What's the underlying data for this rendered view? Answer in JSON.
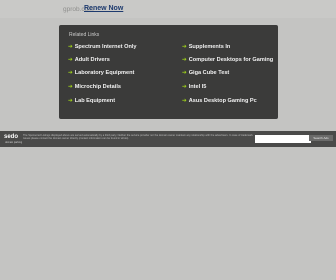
{
  "topbar": {
    "domain": "gprob.com",
    "renew_label": "Renew Now"
  },
  "related": {
    "title": "Related Links",
    "arrow": "➔",
    "left": [
      "Spectrum Internet Only",
      "Adult Drivers",
      "Laboratory Equipment",
      "Microchip Details",
      "Lab Equipment"
    ],
    "right": [
      "Supplements In",
      "Computer Desktops for Gaming",
      "Giga Cube Test",
      "Intel I5",
      "Asus Desktop Gaming Pc"
    ]
  },
  "footer": {
    "logo": "sedo",
    "logo_sub": "domain parking",
    "text": "The Sponsored Listings displayed above are served automatically by a third party. Neither the service provider nor the domain owner maintain any relationship with the advertisers. In case of trademark issues please contact the domain owner directly (contact information can be found in whois).",
    "search_label": "Search Ads"
  }
}
